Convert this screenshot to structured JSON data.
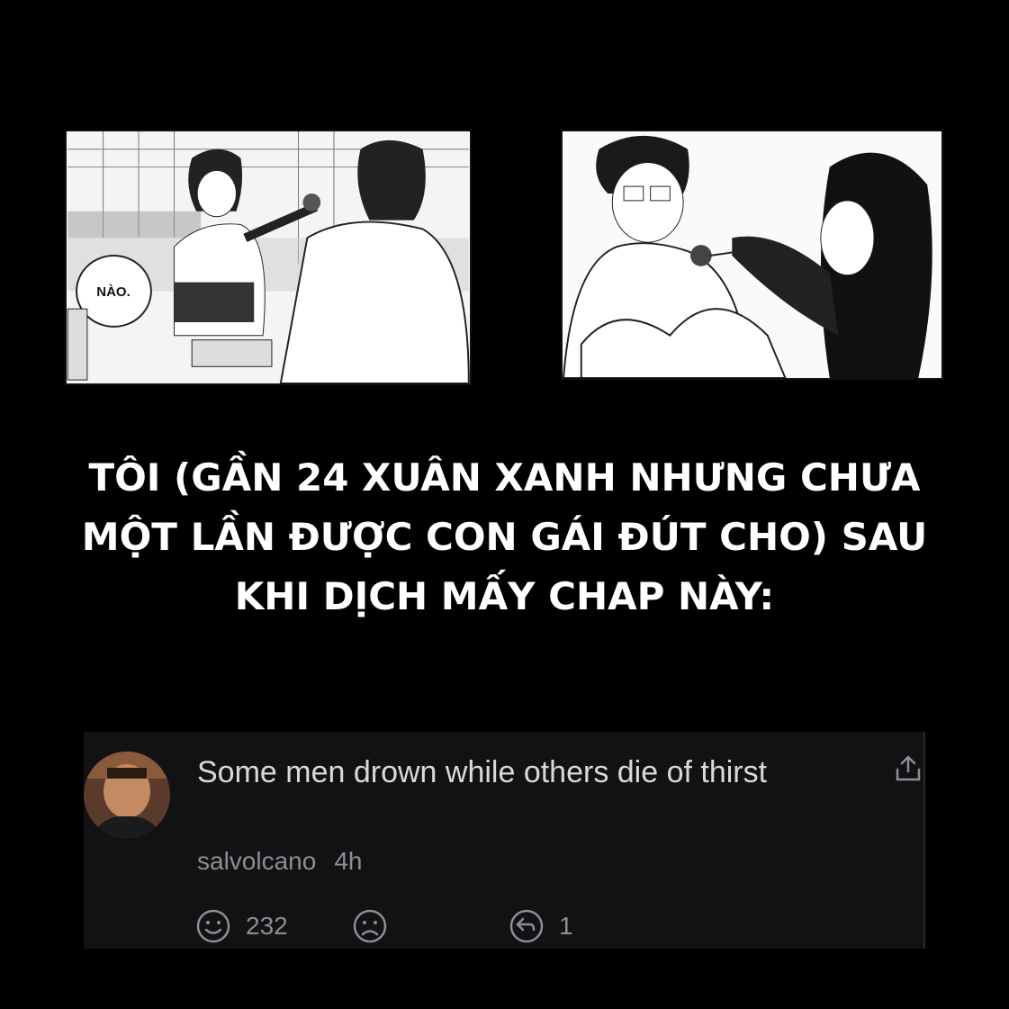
{
  "panels": {
    "left": {
      "speech_bubble": "NÀO."
    },
    "right": {}
  },
  "caption": {
    "lines": [
      "TÔI (GẦN 24 XUÂN XANH NHƯNG CHƯA",
      "MỘT LẦN ĐƯỢC CON GÁI ĐÚT CHO) SAU",
      "KHI DỊCH MẤY CHAP NÀY:"
    ]
  },
  "comment": {
    "text": "Some men drown while others die of thirst",
    "username": "salvolcano",
    "time": "4h",
    "upvotes": "232",
    "replies": "1",
    "icons": {
      "avatar": "avatar-photo",
      "like": "smiley-icon",
      "dislike": "frown-icon",
      "reply": "reply-icon",
      "share": "share-icon"
    },
    "colors": {
      "background": "#121214",
      "text": "#d9d9dc",
      "muted": "#8d8d93"
    }
  }
}
